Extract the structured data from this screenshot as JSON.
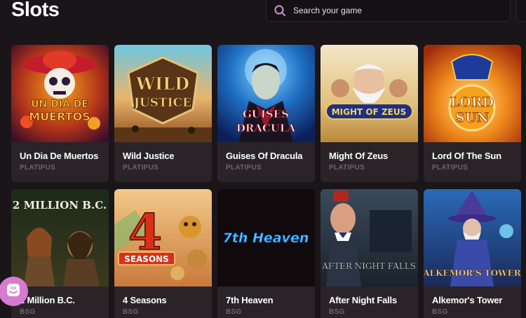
{
  "page": {
    "title": "Slots"
  },
  "search": {
    "placeholder": "Search your game"
  },
  "games": [
    {
      "name": "Un Dia De Muertos",
      "provider": "PLATIPUS",
      "art_text": [
        "UN DIA DE",
        "MUERTOS"
      ]
    },
    {
      "name": "Wild Justice",
      "provider": "PLATIPUS",
      "art_text": [
        "WILD",
        "JUSTICE"
      ]
    },
    {
      "name": "Guises Of Dracula",
      "provider": "PLATIPUS",
      "art_text": [
        "GUISES",
        "DRACULA"
      ]
    },
    {
      "name": "Might Of Zeus",
      "provider": "PLATIPUS",
      "art_text": [
        "MIGHT OF ZEUS"
      ]
    },
    {
      "name": "Lord Of The Sun",
      "provider": "PLATIPUS",
      "art_text": [
        "LORD",
        "SUN"
      ]
    },
    {
      "name": "2 Million B.C.",
      "provider": "BSG",
      "art_text": [
        "2 MILLION B.C."
      ]
    },
    {
      "name": "4 Seasons",
      "provider": "BSG",
      "art_text": [
        "4",
        "SEASONS"
      ]
    },
    {
      "name": "7th Heaven",
      "provider": "BSG",
      "art_text": [
        "7th Heaven"
      ]
    },
    {
      "name": "After Night Falls",
      "provider": "BSG",
      "art_text": [
        "AFTER NIGHT FALLS"
      ]
    },
    {
      "name": "Alkemor's Tower",
      "provider": "BSG",
      "art_text": [
        "ALKEMOR'S TOWER"
      ]
    }
  ],
  "colors": {
    "background": "#1a1519",
    "card": "#2a2429",
    "provider_text": "#6b6470",
    "accent": "#d77bd2"
  },
  "icons": {
    "search": "search-icon",
    "chat": "chat-icon"
  }
}
